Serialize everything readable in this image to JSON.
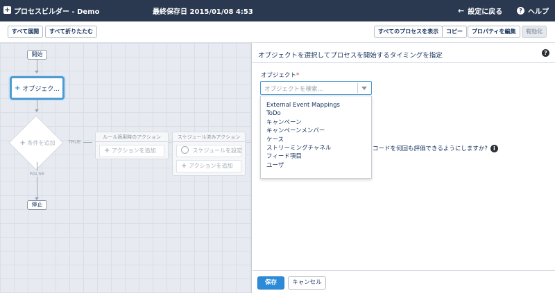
{
  "header": {
    "app_title": "プロセスビルダー - Demo",
    "saved_label": "最終保存日 2015/01/08 4:53",
    "back_label": "設定に戻る",
    "help_label": "ヘルプ"
  },
  "toolbar": {
    "expand_all": "すべて展開",
    "collapse_all": "すべて折りたたむ",
    "show_all_processes": "すべてのプロセスを表示",
    "copy": "コピー",
    "edit_properties": "プロパティを編集",
    "activate": "有効化"
  },
  "canvas": {
    "start_label": "開始",
    "object_node_label": "オブジェク...",
    "criteria_label": "条件を追加",
    "true_label": "TRUE",
    "false_label": "FALSE",
    "stop_label": "停止",
    "immediate_lane_title": "ルール適用時のアクション",
    "immediate_add_action": "アクションを追加",
    "scheduled_lane_title": "スケジュール済みアクション",
    "scheduled_set_schedule": "スケジュールを設定",
    "scheduled_add_action": "アクションを追加"
  },
  "panel": {
    "title": "オブジェクトを選択してプロセスを開始するタイミングを指定",
    "object_label": "オブジェクト",
    "required_mark": "*",
    "search_placeholder": "オブジェクトを検索...",
    "dropdown_options": [
      "External Event Mappings",
      "ToDo",
      "キャンペーン",
      "キャンペーンメンバー",
      "ケース",
      "ストリーミングチャネル",
      "フィード項目",
      "ユーザ"
    ],
    "evaluation_question": "コードを何回も評価できるようにしますか?",
    "save_label": "保存",
    "cancel_label": "キャンセル"
  },
  "colors": {
    "header_bg": "#2a3950",
    "accent": "#2b8bd9",
    "canvas_bg": "#e7ebf1"
  }
}
